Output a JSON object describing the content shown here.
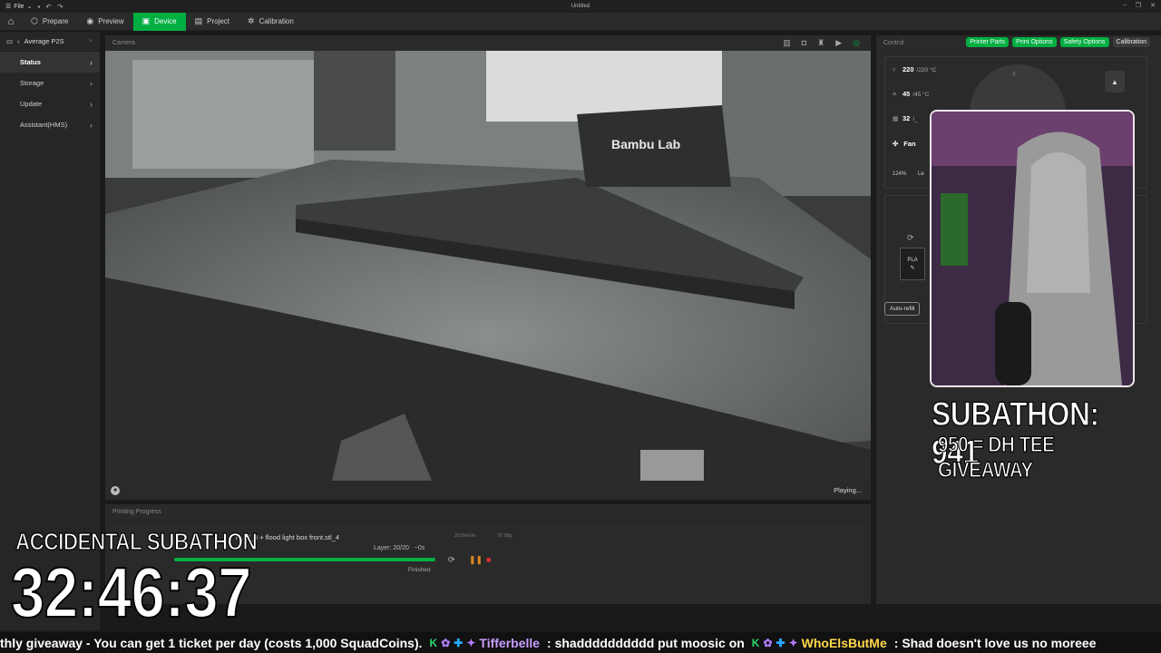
{
  "window": {
    "file_menu": "File",
    "title": "Untitled"
  },
  "tabs": [
    {
      "label": "Prepare",
      "icon": "cube-icon"
    },
    {
      "label": "Preview",
      "icon": "eye-icon"
    },
    {
      "label": "Device",
      "icon": "device-icon",
      "active": true
    },
    {
      "label": "Project",
      "icon": "project-icon"
    },
    {
      "label": "Calibration",
      "icon": "calibration-icon"
    }
  ],
  "sidebar": {
    "device_name": "Average P2S",
    "items": [
      {
        "label": "Status",
        "active": true
      },
      {
        "label": "Storage"
      },
      {
        "label": "Update"
      },
      {
        "label": "Assistant(HMS)"
      }
    ]
  },
  "camera": {
    "header": "Camera",
    "status": "Playing...",
    "brand_text": "Bambu Lab"
  },
  "progress": {
    "header": "Printing Progress",
    "job_name": "nt.stl_3 + flood light box front.stl_4",
    "time_estimate": "2h28m14s",
    "weight": "87.89g",
    "layer": "Layer: 20/20",
    "eta": "~0s",
    "state": "Finished",
    "percent": 100
  },
  "control": {
    "header": "Control",
    "buttons": [
      "Printer Parts",
      "Print Options",
      "Safety Options",
      "Calibration"
    ],
    "nozzle_temp": "220",
    "nozzle_target": "/220 °C",
    "bed_temp": "45",
    "bed_target": "/45 °C",
    "chamber_temp": "32",
    "chamber_target": "/_",
    "fan_label": "Fan",
    "speed_label": "124%",
    "speed_suffix": "Le",
    "jog_y_label": "Y",
    "ams_slot_label": "PLA",
    "auto_refill": "Auto-refill"
  },
  "stream_overlay": {
    "subathon_count": "SUBATHON: 941",
    "giveaway_goal": "950 = DH TEE GIVEAWAY",
    "timer_label": "ACCIDENTAL SUBATHON",
    "timer_value": "32:46:37"
  },
  "ticker": {
    "message1": "thly giveaway - You can get 1 ticket per day (costs 1,000 SquadCoins).",
    "user1": "Tifferbelle",
    "message2": ": shadddddddddd put moosic on",
    "user2": "WhoElsButMe",
    "message3": ": Shad doesn't love us no moreee"
  },
  "colors": {
    "accent": "#00ae42",
    "background": "#1a1a1a",
    "panel": "#2a2a2a"
  }
}
